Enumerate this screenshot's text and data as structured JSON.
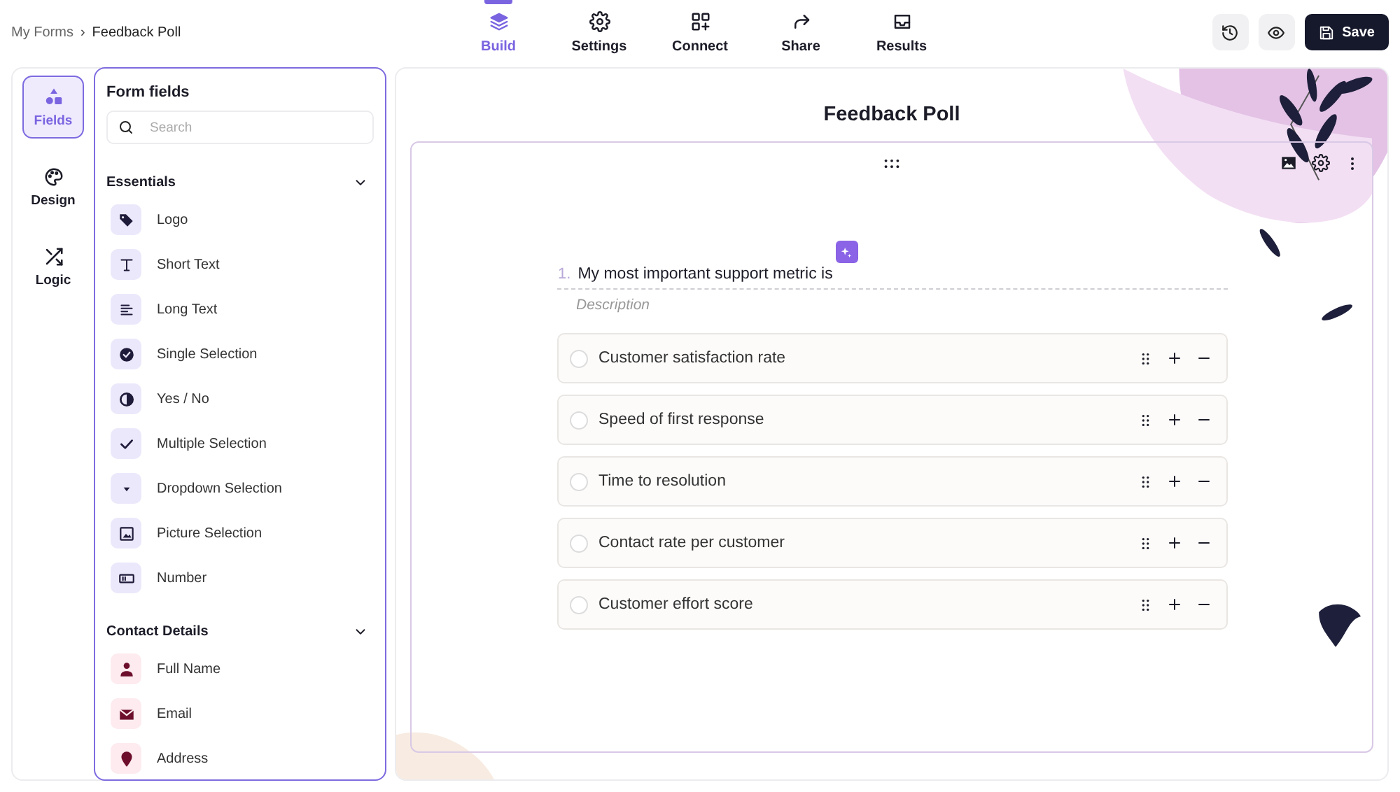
{
  "breadcrumb": {
    "parent": "My Forms",
    "separator": "›",
    "current": "Feedback Poll"
  },
  "nav_tabs": [
    {
      "label": "Build",
      "selected": true
    },
    {
      "label": "Settings",
      "selected": false
    },
    {
      "label": "Connect",
      "selected": false
    },
    {
      "label": "Share",
      "selected": false
    },
    {
      "label": "Results",
      "selected": false
    }
  ],
  "save_button": {
    "label": "Save"
  },
  "rail": [
    {
      "label": "Fields",
      "selected": true
    },
    {
      "label": "Design",
      "selected": false
    },
    {
      "label": "Logic",
      "selected": false
    }
  ],
  "fields_panel": {
    "title": "Form fields",
    "search": {
      "placeholder": "Search"
    },
    "groups": [
      {
        "title": "Essentials",
        "expanded": true,
        "items": [
          {
            "label": "Logo",
            "kind": "logo"
          },
          {
            "label": "Short Text",
            "kind": "short"
          },
          {
            "label": "Long Text",
            "kind": "long"
          },
          {
            "label": "Single Selection",
            "kind": "single"
          },
          {
            "label": "Yes / No",
            "kind": "yesno"
          },
          {
            "label": "Multiple Selection",
            "kind": "multiple"
          },
          {
            "label": "Dropdown Selection",
            "kind": "dropdown"
          },
          {
            "label": "Picture Selection",
            "kind": "picture"
          },
          {
            "label": "Number",
            "kind": "number"
          }
        ]
      },
      {
        "title": "Contact Details",
        "expanded": true,
        "items": [
          {
            "label": "Full Name",
            "kind": "person"
          },
          {
            "label": "Email",
            "kind": "email"
          },
          {
            "label": "Address",
            "kind": "address"
          }
        ]
      }
    ]
  },
  "form": {
    "title": "Feedback Poll",
    "question": {
      "number": "1.",
      "text": "My most important support metric is",
      "description_placeholder": "Description",
      "options": [
        {
          "label": "Customer satisfaction rate",
          "selected": false
        },
        {
          "label": "Speed of first response",
          "selected": false
        },
        {
          "label": "Time to resolution",
          "selected": false
        },
        {
          "label": "Contact rate per customer",
          "selected": false
        },
        {
          "label": "Customer effort score",
          "selected": false
        }
      ]
    }
  }
}
